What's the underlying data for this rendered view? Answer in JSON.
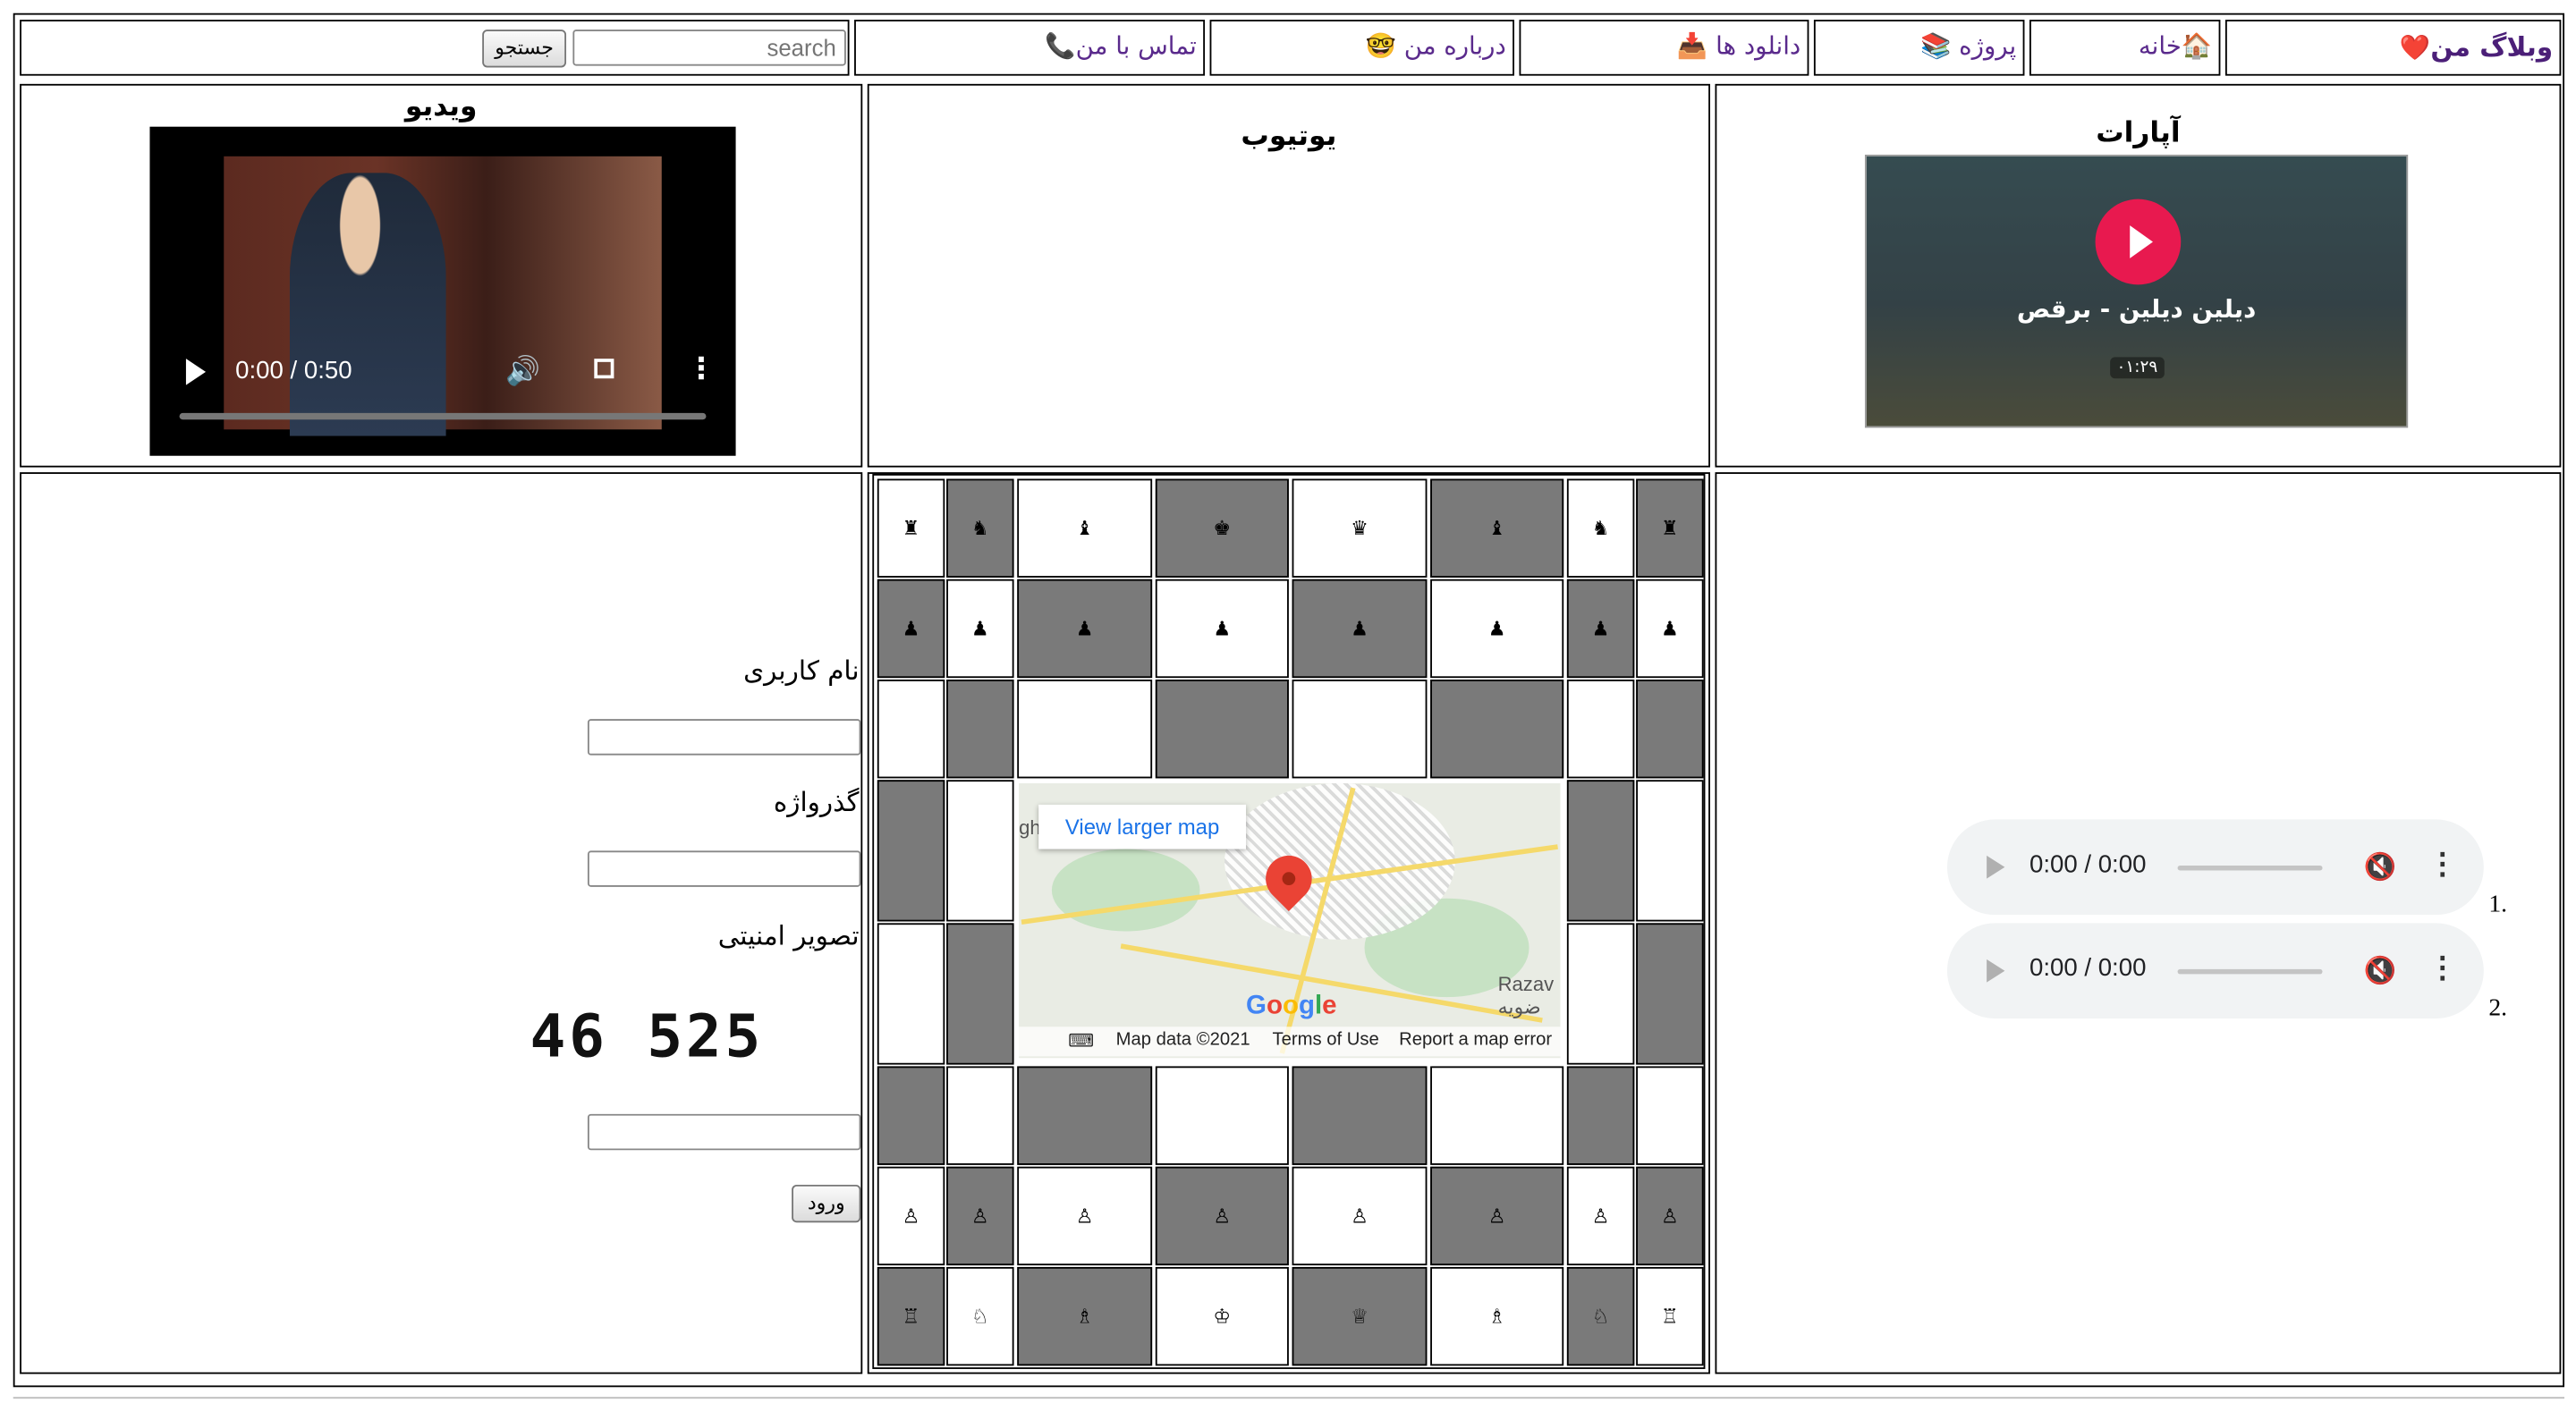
{
  "nav": {
    "logo": "وبلاگ من",
    "logo_emoji": "❤️",
    "items": [
      {
        "label": "خانه",
        "emoji": "🏠"
      },
      {
        "label": "پروژه",
        "emoji": "📚"
      },
      {
        "label": "دانلود ها",
        "emoji": "📥"
      },
      {
        "label": "درباره من",
        "emoji": "🤓"
      },
      {
        "label": "تماس با من",
        "emoji": "📞"
      }
    ],
    "search_placeholder": "search",
    "search_button": "جستجو"
  },
  "media": {
    "aparat_title": "آپارات",
    "aparat_video_title": "دیلین دیلین - برقص",
    "aparat_duration": "۰۱:۲۹",
    "youtube_title": "یوتیوب",
    "video_title": "ویدیو",
    "video_time": "0:00 / 0:50",
    "video_progress": 0
  },
  "audio": {
    "items": [
      {
        "number": "1.",
        "time": "0:00 / 0:00"
      },
      {
        "number": "2.",
        "time": "0:00 / 0:00"
      }
    ]
  },
  "chess": {
    "rows": [
      [
        "♜",
        "♞",
        "♝",
        "♚",
        "♛",
        "♝",
        "♞",
        "♜"
      ],
      [
        "♟",
        "♟",
        "♟",
        "♟",
        "♟",
        "♟",
        "♟",
        "♟"
      ],
      [
        "",
        "",
        "",
        "",
        "",
        "",
        "",
        ""
      ],
      [
        "",
        "",
        "",
        "",
        "",
        "",
        "",
        ""
      ],
      [
        "",
        "",
        "",
        "",
        "",
        "",
        "",
        ""
      ],
      [
        "",
        "",
        "",
        "",
        "",
        "",
        "",
        ""
      ],
      [
        "♙",
        "♙",
        "♙",
        "♙",
        "♙",
        "♙",
        "♙",
        "♙"
      ],
      [
        "♖",
        "♘",
        "♗",
        "♔",
        "♕",
        "♗",
        "♘",
        "♖"
      ]
    ]
  },
  "map": {
    "link": "View larger map",
    "logo": "Google",
    "data": "Map data ©2021",
    "terms": "Terms of Use",
    "report": "Report a map error",
    "place": "Razav",
    "place_fa": "ضویه",
    "edge_text": "gh"
  },
  "login": {
    "username_label": "نام کاربری",
    "password_label": "گذرواژه",
    "captcha_label": "تصویر امنیتی",
    "captcha_text": "46 525",
    "submit": "ورود"
  }
}
